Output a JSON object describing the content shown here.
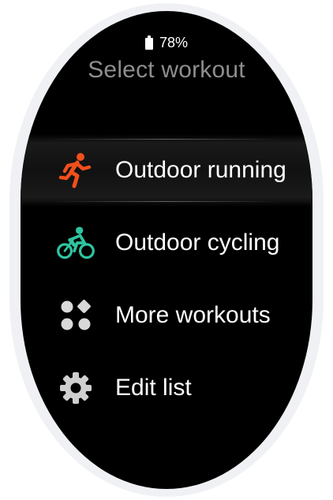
{
  "status": {
    "battery_percent": "78%",
    "battery_icon": "battery-icon"
  },
  "header": {
    "title": "Select workout"
  },
  "workouts": [
    {
      "label": "Outdoor running",
      "icon": "running-icon",
      "icon_color": "#f04f1c",
      "selected": true
    },
    {
      "label": "Outdoor cycling",
      "icon": "cycling-icon",
      "icon_color": "#2ec4a0",
      "selected": false
    },
    {
      "label": "More workouts",
      "icon": "grid-icon",
      "icon_color": "#d9d9d9",
      "selected": false
    },
    {
      "label": "Edit list",
      "icon": "gear-icon",
      "icon_color": "#cfcfcf",
      "selected": false
    }
  ]
}
